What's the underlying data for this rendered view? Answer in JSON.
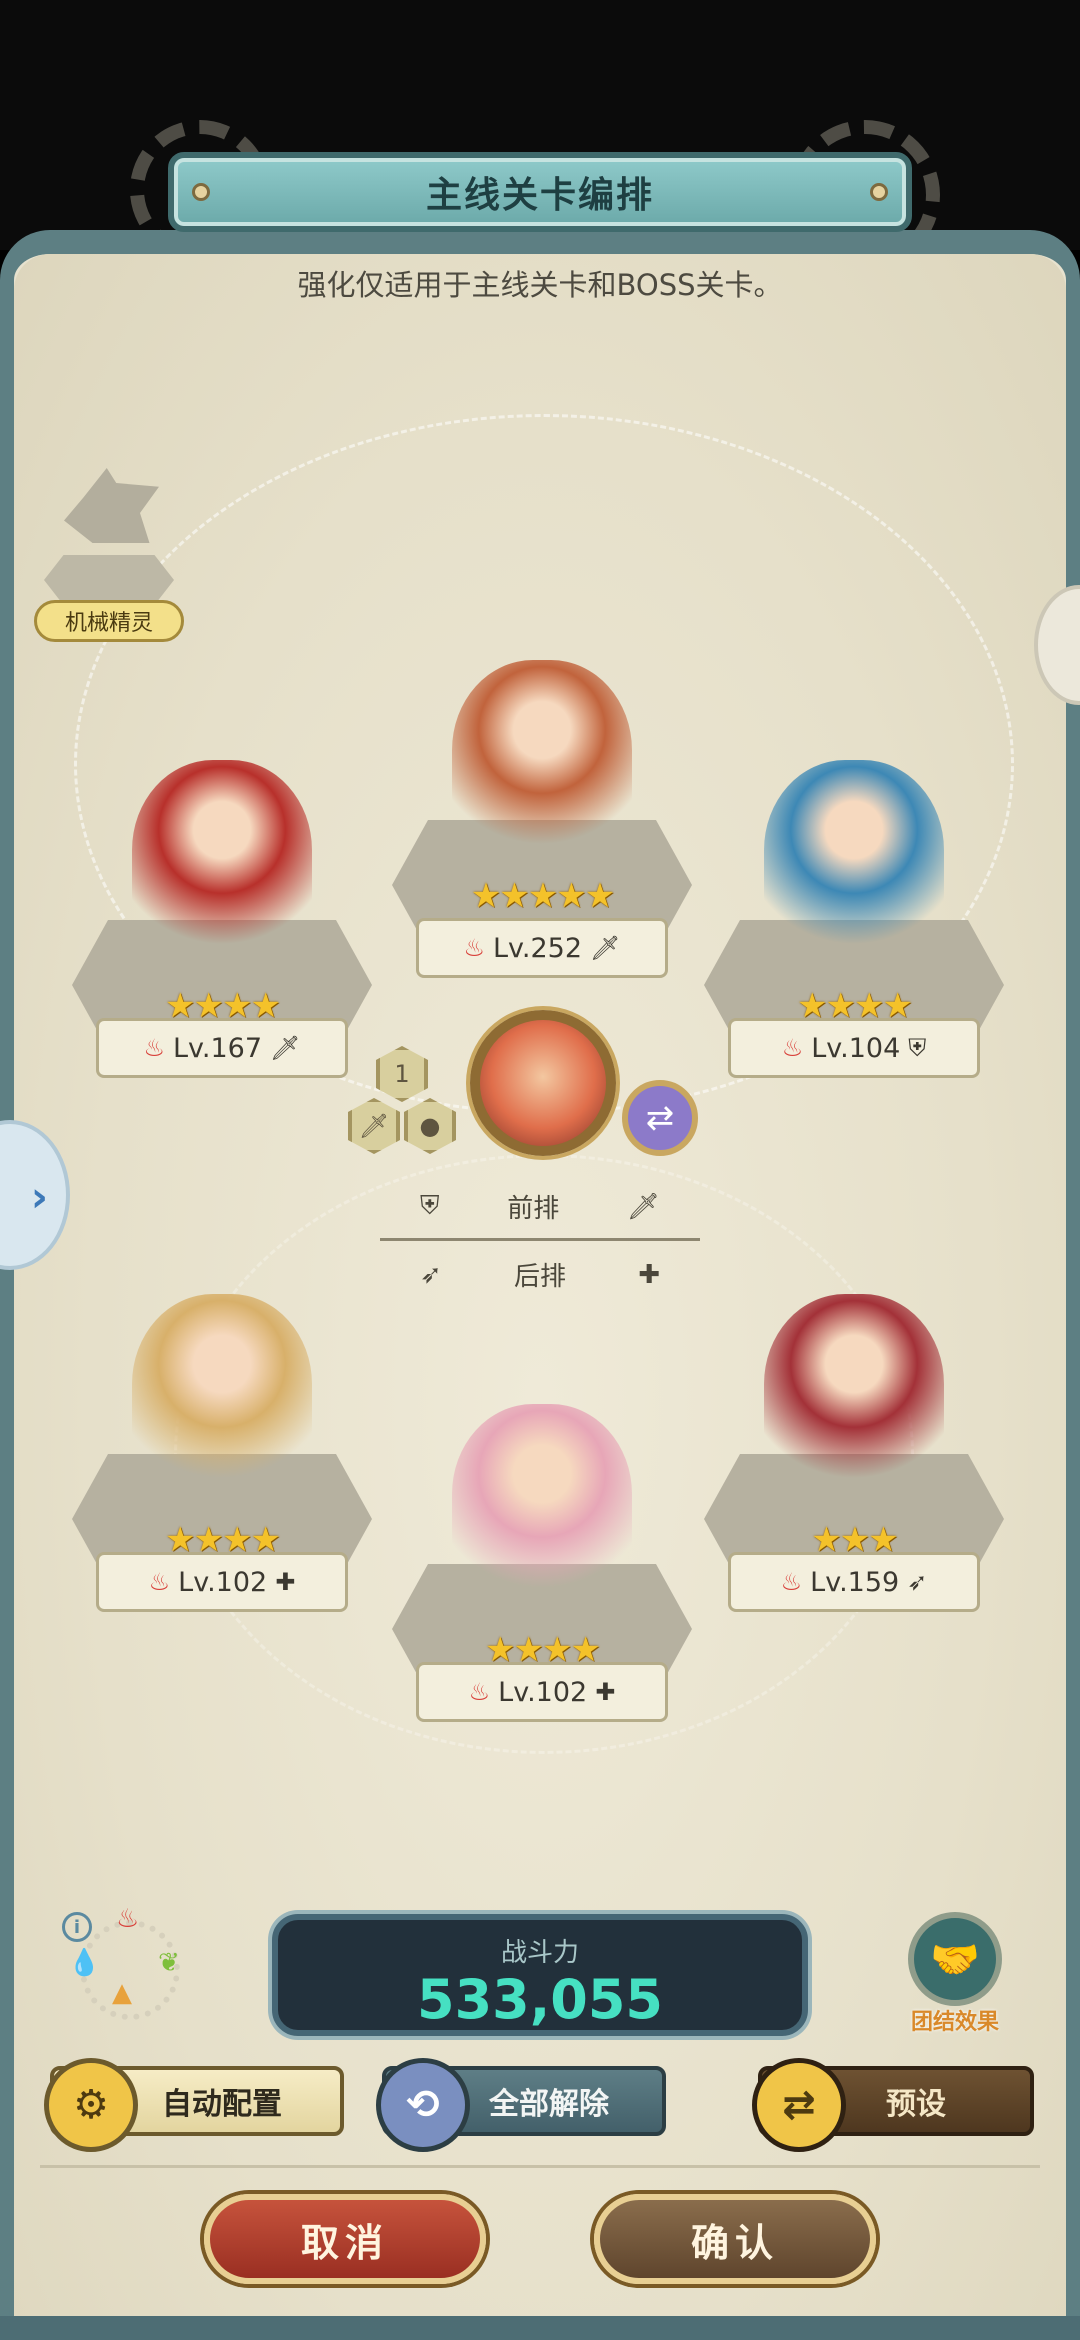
{
  "header": {
    "title": "主线关卡编排",
    "subtitle": "强化仅适用于主线关卡和BOSS关卡。"
  },
  "spirit": {
    "label": "机械精灵"
  },
  "heroes": [
    {
      "id": "top-center",
      "stars": "★★★★★",
      "level": "Lv.252",
      "role_icon": "sword-icon",
      "role_glyph": "🗡",
      "color": "#c1633c"
    },
    {
      "id": "top-left",
      "stars": "★★★★",
      "level": "Lv.167",
      "role_icon": "sword-icon",
      "role_glyph": "🗡",
      "color": "#b8302b"
    },
    {
      "id": "top-right",
      "stars": "★★★★",
      "level": "Lv.104",
      "role_icon": "shield-icon",
      "role_glyph": "⛨",
      "color": "#3d88b5"
    },
    {
      "id": "bottom-left",
      "stars": "★★★★",
      "level": "Lv.102",
      "role_icon": "plus-icon",
      "role_glyph": "✚",
      "color": "#d8b06a"
    },
    {
      "id": "bottom-center",
      "stars": "★★★★",
      "level": "Lv.102",
      "role_icon": "plus-icon",
      "role_glyph": "✚",
      "color": "#e7a6b7"
    },
    {
      "id": "bottom-right",
      "stars": "★★★",
      "level": "Lv.159",
      "role_icon": "bow-icon",
      "role_glyph": "➶",
      "color": "#a33138"
    }
  ],
  "formation": {
    "leader_badge": "1",
    "front_label": "前排",
    "back_label": "后排"
  },
  "power": {
    "label": "战斗力",
    "value": "533,055"
  },
  "bond": {
    "label": "团结效果"
  },
  "buttons": {
    "auto": "自动配置",
    "clear": "全部解除",
    "preset": "预设",
    "cancel": "取消",
    "confirm": "确认"
  }
}
